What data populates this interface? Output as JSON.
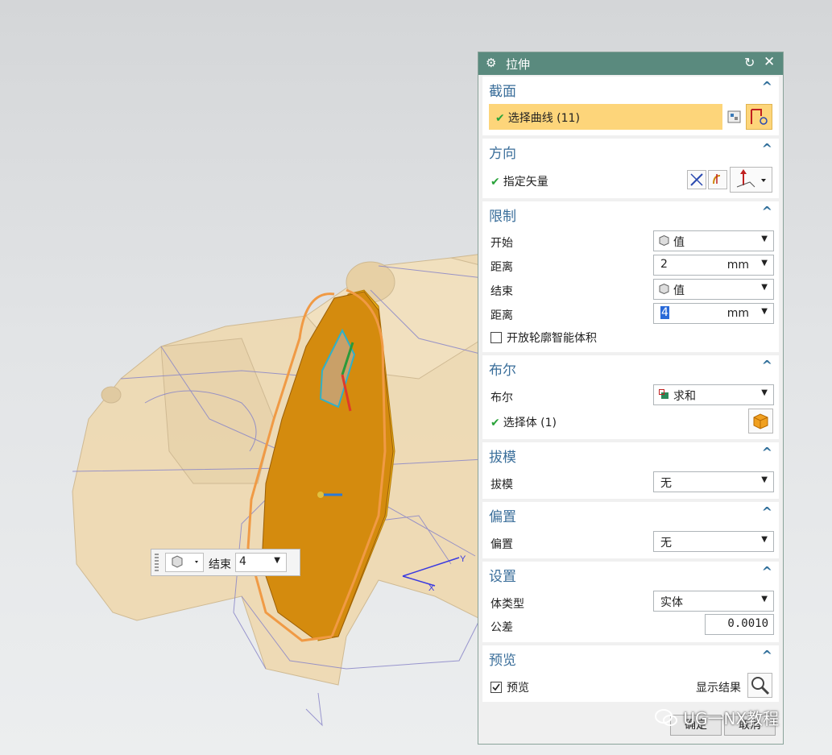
{
  "dialog": {
    "title": "拉伸",
    "sections": {
      "section": {
        "header": "截面",
        "select_curve": "选择曲线 (11)"
      },
      "direction": {
        "header": "方向",
        "specify_vector": "指定矢量"
      },
      "limits": {
        "header": "限制",
        "start_label": "开始",
        "start_value": "值",
        "distance1_label": "距离",
        "distance1_value": "2",
        "distance1_unit": "mm",
        "end_label": "结束",
        "end_value": "值",
        "distance2_label": "距离",
        "distance2_value": "4",
        "distance2_unit": "mm",
        "open_profile": "开放轮廓智能体积"
      },
      "boolean": {
        "header": "布尔",
        "boolean_label": "布尔",
        "boolean_value": "求和",
        "select_body": "选择体 (1)"
      },
      "draft": {
        "header": "拔模",
        "draft_label": "拔模",
        "draft_value": "无"
      },
      "offset": {
        "header": "偏置",
        "offset_label": "偏置",
        "offset_value": "无"
      },
      "settings": {
        "header": "设置",
        "body_type_label": "体类型",
        "body_type_value": "实体",
        "tolerance_label": "公差",
        "tolerance_value": "0.0010"
      },
      "preview": {
        "header": "预览",
        "preview_label": "预览",
        "show_result": "显示结果"
      }
    },
    "ok": "确定",
    "cancel": "取消"
  },
  "onscreen_input": {
    "label": "结束",
    "value": "4"
  },
  "watermark": "UG一NX教程",
  "axis_labels": {
    "x": "X",
    "y": "Y"
  },
  "colors": {
    "titlebar": "#5a8a7e",
    "section_header": "#3a6e9a",
    "highlight": "#fdd57a",
    "part_orange": "#d48b0e"
  }
}
